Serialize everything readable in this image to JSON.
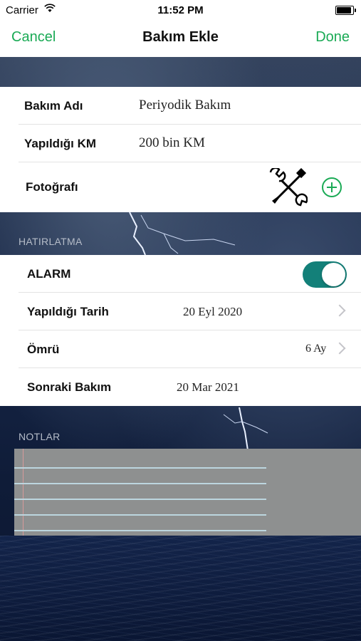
{
  "status_bar": {
    "carrier": "Carrier",
    "time": "11:52 PM"
  },
  "nav": {
    "cancel_label": "Cancel",
    "title": "Bakım Ekle",
    "done_label": "Done"
  },
  "maintenance": {
    "name_label": "Bakım Adı",
    "name_value": "Periyodik Bakım",
    "km_label": "Yapıldığı KM",
    "km_value": "200 bin KM",
    "photo_label": "Fotoğrafı",
    "photo_icon": "tools-icon",
    "add_icon": "add-circle-icon"
  },
  "reminder": {
    "section_title": "HATIRLATMA",
    "alarm_label": "ALARM",
    "alarm_on": true,
    "date_label": "Yapıldığı Tarih",
    "date_value": "20 Eyl 2020",
    "lifetime_label": "Ömrü",
    "lifetime_value": "6 Ay",
    "next_label": "Sonraki Bakım",
    "next_value": "20 Mar 2021"
  },
  "notes": {
    "section_title": "NOTLAR",
    "text": ""
  },
  "colors": {
    "accent": "#1aaa55",
    "toggle_on": "#138079"
  }
}
